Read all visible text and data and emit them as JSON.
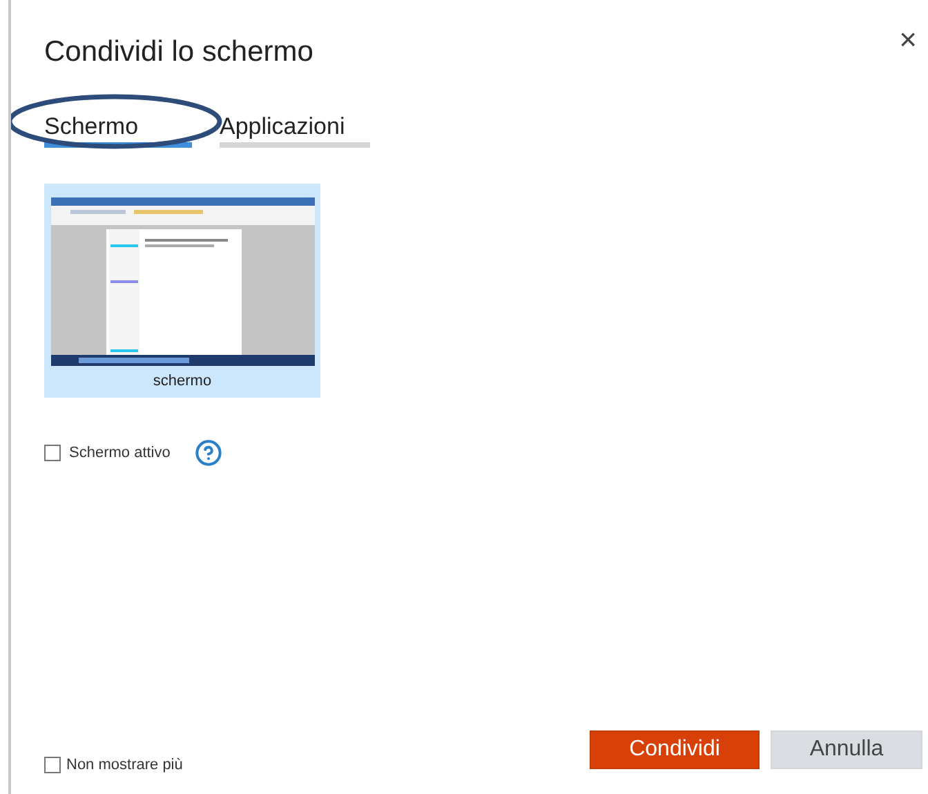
{
  "window": {
    "title": "Condividi lo schermo",
    "close": "×"
  },
  "tabs": [
    {
      "label": "Schermo",
      "selected": true,
      "circled": true
    },
    {
      "label": "Applicazioni",
      "selected": false,
      "circled": false
    }
  ],
  "sources": [
    {
      "label": "schermo",
      "selected": true
    }
  ],
  "options": [
    {
      "label": "Schermo attivo",
      "checked": false,
      "help": true
    }
  ],
  "footer": {
    "checkbox": {
      "label": "Non mostrare più",
      "checked": false
    },
    "buttons": [
      {
        "label": "Condividi",
        "kind": "primary"
      },
      {
        "label": "Annulla",
        "kind": "secondary"
      }
    ]
  }
}
